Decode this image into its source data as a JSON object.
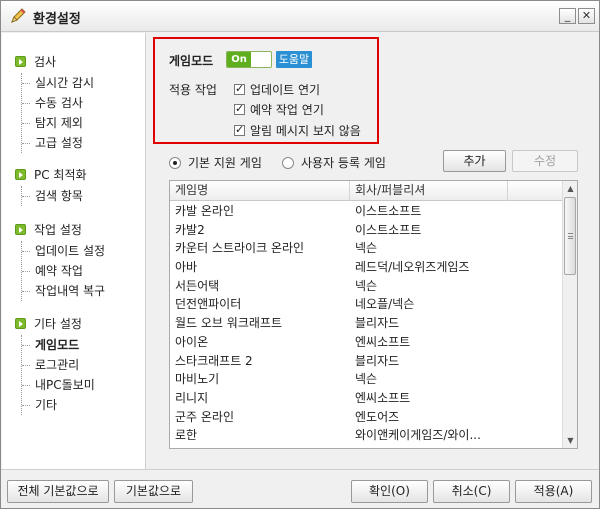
{
  "window": {
    "title": "환경설정",
    "minimize_label": "_",
    "close_label": "✕"
  },
  "sidebar": {
    "groups": [
      {
        "title": "검사",
        "items": [
          "실시간 감시",
          "수동 검사",
          "탐지 제외",
          "고급 설정"
        ]
      },
      {
        "title": "PC 최적화",
        "items": [
          "검색 항목"
        ]
      },
      {
        "title": "작업 설정",
        "items": [
          "업데이트 설정",
          "예약 작업",
          "작업내역 복구"
        ]
      },
      {
        "title": "기타 설정",
        "items": [
          "게임모드",
          "로그관리",
          "내PC돌보미",
          "기타"
        ]
      }
    ],
    "active_item": "게임모드"
  },
  "game_mode": {
    "title": "게임모드",
    "toggle_label": "On",
    "toggle_state": "on",
    "help_label": "도움말",
    "apply_label": "적용 작업",
    "options": [
      {
        "label": "업데이트 연기",
        "checked": true
      },
      {
        "label": "예약 작업 연기",
        "checked": true
      },
      {
        "label": "알림 메시지 보지 않음",
        "checked": true
      }
    ]
  },
  "game_source": {
    "options": [
      {
        "label": "기본 지원 게임",
        "checked": true
      },
      {
        "label": "사용자 등록 게임",
        "checked": false
      }
    ],
    "add_label": "추가",
    "edit_label": "수정"
  },
  "table": {
    "columns": [
      "게임명",
      "회사/퍼블리셔",
      ""
    ],
    "rows": [
      [
        "카발 온라인",
        "이스트소프트"
      ],
      [
        "카발2",
        "이스트소프트"
      ],
      [
        "카운터 스트라이크 온라인",
        "넥슨"
      ],
      [
        "아바",
        "레드덕/네오위즈게임즈"
      ],
      [
        "서든어택",
        "넥슨"
      ],
      [
        "던전앤파이터",
        "네오플/넥슨"
      ],
      [
        "월드 오브 워크래프트",
        "블리자드"
      ],
      [
        "아이온",
        "엔씨소프트"
      ],
      [
        "스타크래프트 2",
        "블리자드"
      ],
      [
        "마비노기",
        "넥슨"
      ],
      [
        "리니지",
        "엔씨소프트"
      ],
      [
        "군주 온라인",
        "엔도어즈"
      ],
      [
        "로한",
        "와이앤케이게임즈/와이..."
      ]
    ]
  },
  "bottom": {
    "reset_all_label": "전체 기본값으로",
    "reset_label": "기본값으로",
    "ok_label": "확인(O)",
    "cancel_label": "취소(C)",
    "apply_label": "적용(A)"
  },
  "icons": {
    "app": "pencil-icon",
    "group": "green-arrow-icon"
  },
  "colors": {
    "toggle_on": "#5fae1e",
    "help": "#2a8fd3",
    "highlight_border": "#e00000"
  }
}
